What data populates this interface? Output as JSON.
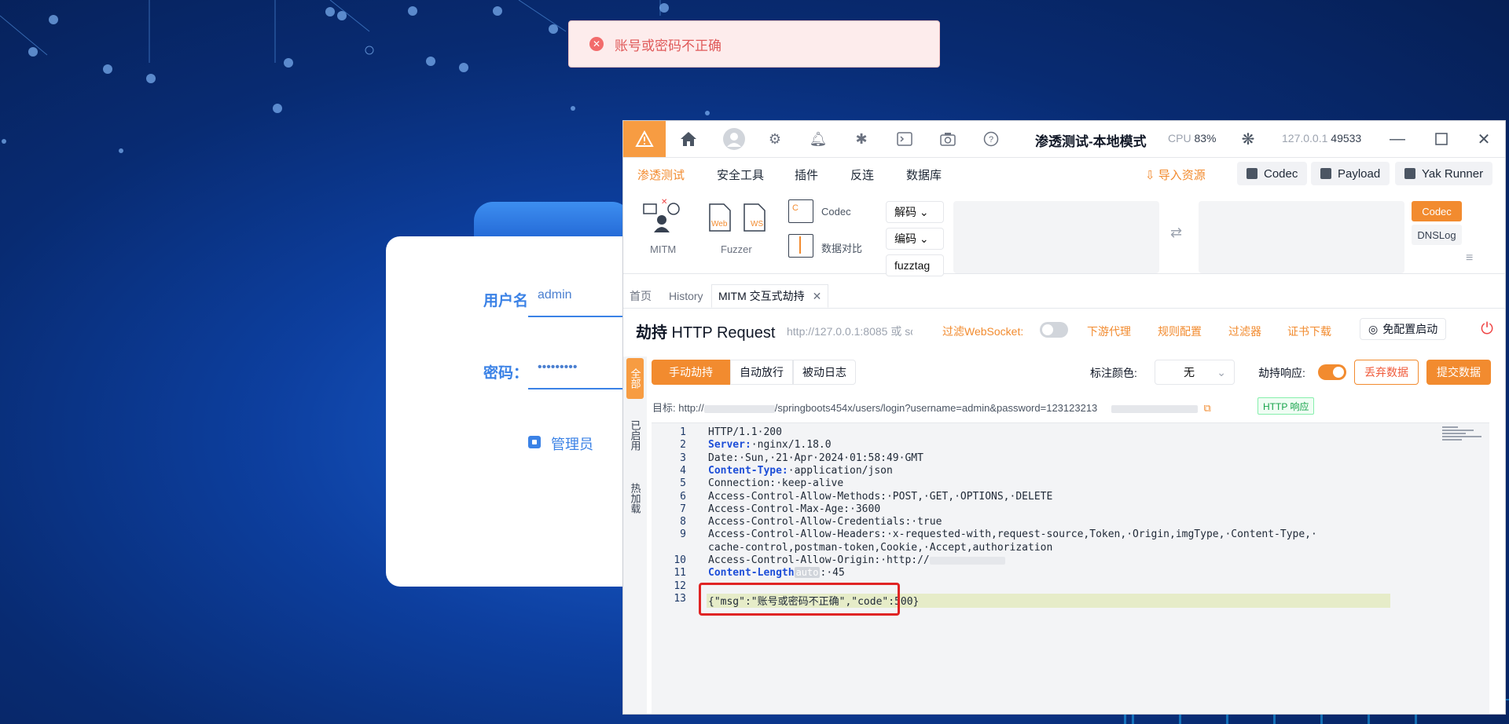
{
  "toast": {
    "message": "账号或密码不正确",
    "icon": "error-circle-icon"
  },
  "login": {
    "username_label": "用户名",
    "username_value": "admin",
    "password_label": "密码：",
    "password_value": "•••••••••",
    "role_label": "管理员"
  },
  "titlebar": {
    "title": "渗透测试-本地模式",
    "cpu_label": "CPU",
    "cpu_value": "83%",
    "host": "127.0.0.1",
    "port": "49533"
  },
  "menu": {
    "items": [
      "渗透测试",
      "安全工具",
      "插件",
      "反连",
      "数据库"
    ],
    "import": "导入资源",
    "buttons": [
      "Codec",
      "Payload",
      "Yak Runner"
    ]
  },
  "tools": {
    "mitm": "MITM",
    "fuzzer": "Fuzzer",
    "web": "Web",
    "ws": "WS",
    "codec": "Codec",
    "compare": "数据对比",
    "decode": "解码",
    "encode": "编码",
    "fuzztag": "fuzztag",
    "side_codec": "Codec",
    "side_dnslog": "DNSLog"
  },
  "tabs": [
    "首页",
    "History",
    "MITM 交互式劫持"
  ],
  "header": {
    "title_bold": "劫持",
    "title_rest": " HTTP Request",
    "url": "http://127.0.0.1:8085 或 soc...",
    "filter_ws": "过滤WebSocket:",
    "links": [
      "下游代理",
      "规则配置",
      "过滤器",
      "证书下载"
    ],
    "chrome": "免配置启动"
  },
  "vtabs": [
    "全部",
    "已启用",
    "热加载"
  ],
  "controls": {
    "segments": [
      "手动劫持",
      "自动放行",
      "被动日志"
    ],
    "color_label": "标注颜色:",
    "color_value": "无",
    "hijack_resp_label": "劫持响应:",
    "discard": "丢弃数据",
    "submit": "提交数据"
  },
  "target": {
    "prefix": "目标:",
    "scheme": "http://",
    "path": "/springboots454x/users/login?username=admin&password=123123213",
    "tag": "HTTP 响应"
  },
  "code_lines": [
    {
      "n": "1",
      "k": "",
      "t": "HTTP/1.1·200"
    },
    {
      "n": "2",
      "k": "Server:",
      "t": "·nginx/1.18.0"
    },
    {
      "n": "3",
      "k": "",
      "t": "Date:·Sun,·21·Apr·2024·01:58:49·GMT"
    },
    {
      "n": "4",
      "k": "Content-Type:",
      "t": "·application/json"
    },
    {
      "n": "5",
      "k": "",
      "t": "Connection:·keep-alive"
    },
    {
      "n": "6",
      "k": "",
      "t": "Access-Control-Allow-Methods:·POST,·GET,·OPTIONS,·DELETE"
    },
    {
      "n": "7",
      "k": "",
      "t": "Access-Control-Max-Age:·3600"
    },
    {
      "n": "8",
      "k": "",
      "t": "Access-Control-Allow-Credentials:·true"
    },
    {
      "n": "9",
      "k": "",
      "t": "Access-Control-Allow-Headers:·x-requested-with,request-source,Token,·Origin,imgType,·Content-Type,·"
    },
    {
      "n": "",
      "k": "",
      "t": "cache-control,postman-token,Cookie,·Accept,authorization"
    },
    {
      "n": "10",
      "k": "",
      "t": "Access-Control-Allow-Origin:·http://"
    },
    {
      "n": "11",
      "k": "Content-Length",
      "t": "·45"
    },
    {
      "n": "12",
      "k": "",
      "t": ""
    },
    {
      "n": "13",
      "k": "",
      "t": "{\"msg\":\"账号或密码不正确\",\"code\":500}"
    }
  ],
  "auto_tag": "auto",
  "colors": {
    "accent": "#f28b2f",
    "error": "#e02424",
    "bg": "#0d3f9f"
  }
}
